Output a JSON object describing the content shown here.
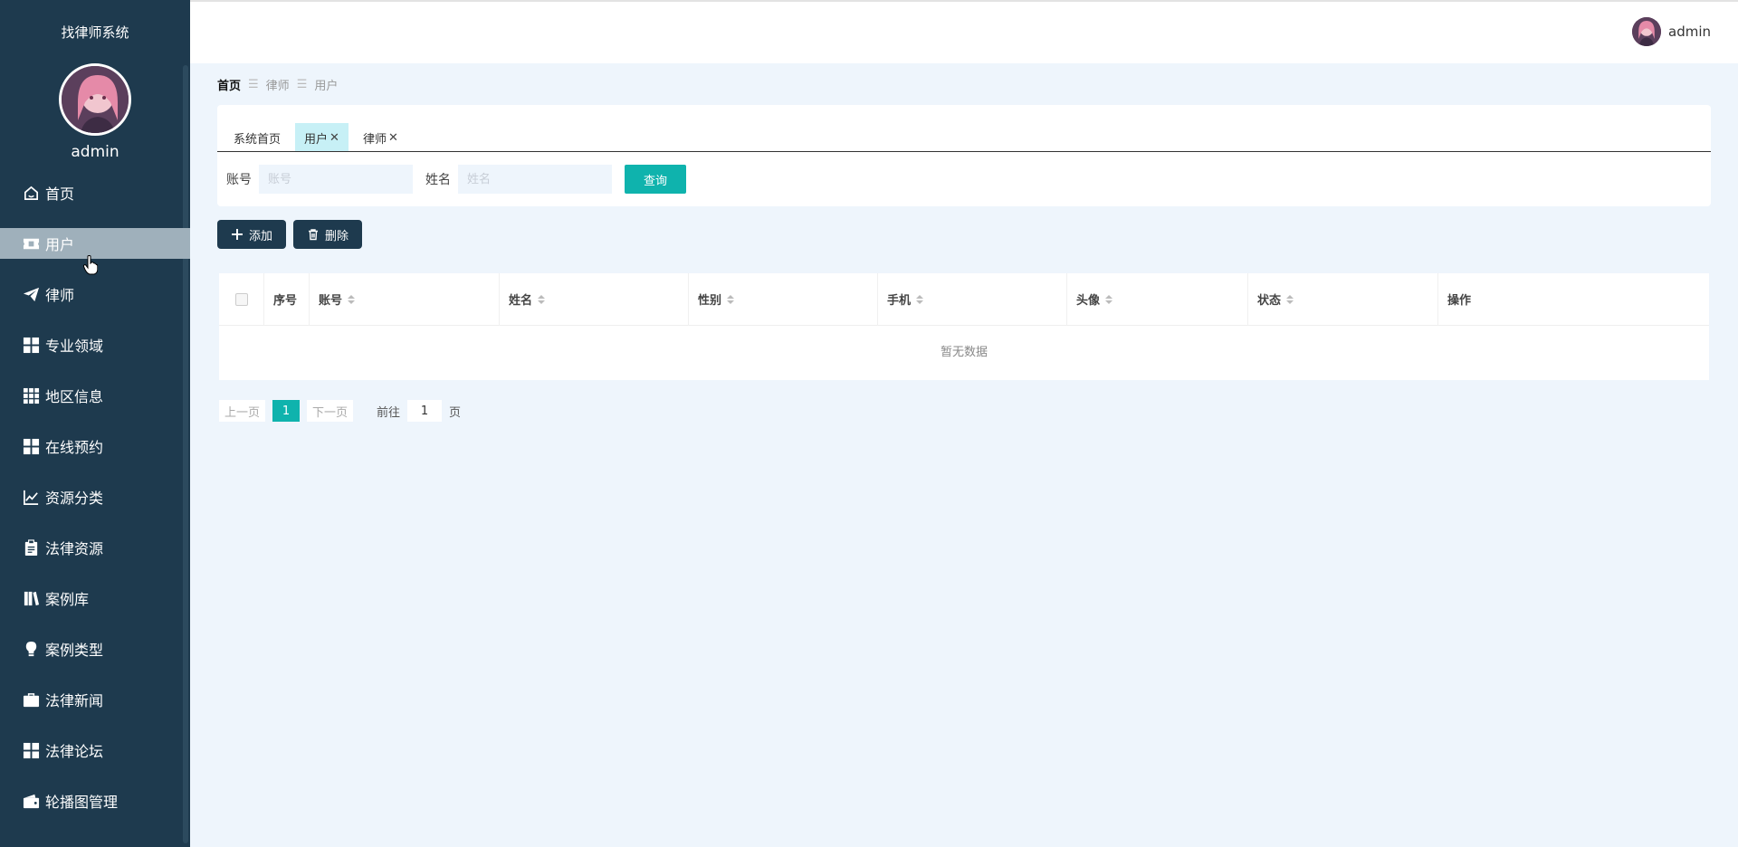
{
  "app": {
    "title": "找律师系统",
    "username": "admin"
  },
  "sidebar": {
    "items": [
      {
        "label": "首页",
        "icon": "home-icon",
        "active": false
      },
      {
        "label": "用户",
        "icon": "ticket-icon",
        "active": true
      },
      {
        "label": "律师",
        "icon": "paper-plane-icon",
        "active": false
      },
      {
        "label": "专业领域",
        "icon": "grid-icon",
        "active": false
      },
      {
        "label": "地区信息",
        "icon": "grid-nine-icon",
        "active": false
      },
      {
        "label": "在线预约",
        "icon": "grid-icon",
        "active": false
      },
      {
        "label": "资源分类",
        "icon": "chart-line-icon",
        "active": false
      },
      {
        "label": "法律资源",
        "icon": "clipboard-icon",
        "active": false
      },
      {
        "label": "案例库",
        "icon": "book-icon",
        "active": false
      },
      {
        "label": "案例类型",
        "icon": "lightbulb-icon",
        "active": false
      },
      {
        "label": "法律新闻",
        "icon": "briefcase-icon",
        "active": false
      },
      {
        "label": "法律论坛",
        "icon": "grid-icon",
        "active": false
      },
      {
        "label": "轮播图管理",
        "icon": "wallet-icon",
        "active": false
      }
    ]
  },
  "topbar": {
    "username": "admin"
  },
  "breadcrumb": {
    "home": "首页",
    "items": [
      "律师",
      "用户"
    ]
  },
  "tabs": [
    {
      "label": "系统首页",
      "closable": false,
      "active": false
    },
    {
      "label": "用户",
      "closable": true,
      "active": true
    },
    {
      "label": "律师",
      "closable": true,
      "active": false
    }
  ],
  "search": {
    "account_label": "账号",
    "account_placeholder": "账号",
    "name_label": "姓名",
    "name_placeholder": "姓名",
    "query_label": "查询"
  },
  "actions": {
    "add_label": "添加",
    "delete_label": "删除"
  },
  "table": {
    "columns": [
      {
        "label": "序号",
        "sortable": false
      },
      {
        "label": "账号",
        "sortable": true
      },
      {
        "label": "姓名",
        "sortable": true
      },
      {
        "label": "性别",
        "sortable": true
      },
      {
        "label": "手机",
        "sortable": true
      },
      {
        "label": "头像",
        "sortable": true
      },
      {
        "label": "状态",
        "sortable": true
      },
      {
        "label": "操作",
        "sortable": false
      }
    ],
    "empty_text": "暂无数据"
  },
  "pager": {
    "prev": "上一页",
    "current": "1",
    "next": "下一页",
    "goto_label": "前往",
    "goto_value": "1",
    "unit": "页"
  },
  "colors": {
    "sidebar_bg": "#1e3a4e",
    "accent": "#0fb3ad",
    "page_bg": "#eef5fc"
  }
}
